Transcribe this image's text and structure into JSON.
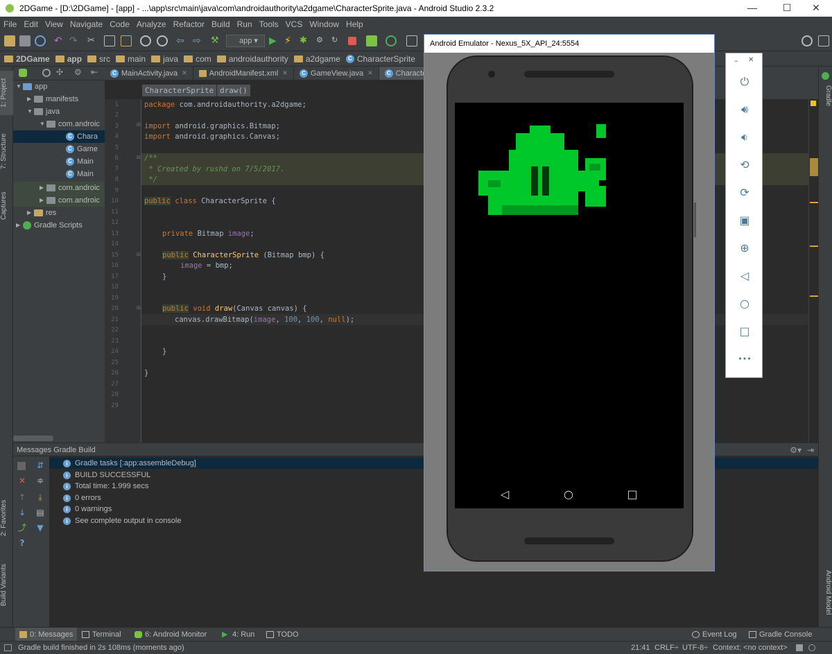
{
  "window": {
    "title": "2DGame - [D:\\2DGame] - [app] - ...\\app\\src\\main\\java\\com\\androidauthority\\a2dgame\\CharacterSprite.java - Android Studio 2.3.2",
    "min": "—",
    "max": "☐",
    "close": "✕"
  },
  "menu": [
    "File",
    "Edit",
    "View",
    "Navigate",
    "Code",
    "Analyze",
    "Refactor",
    "Build",
    "Run",
    "Tools",
    "VCS",
    "Window",
    "Help"
  ],
  "toolbar": {
    "run_config": "app"
  },
  "breadcrumbs": [
    "2DGame",
    "app",
    "src",
    "main",
    "java",
    "com",
    "androidauthority",
    "a2dgame",
    "CharacterSprite"
  ],
  "left_tabs": {
    "project": "1: Project",
    "structure": "7: Structure",
    "captures": "Captures",
    "favorites": "2: Favorites",
    "variants": "Build Variants"
  },
  "right_tabs": {
    "gradle": "Gradle",
    "model": "Android Model"
  },
  "project_tree": [
    {
      "label": "app",
      "kind": "folder"
    },
    {
      "label": "manifests",
      "kind": "folder"
    },
    {
      "label": "java",
      "kind": "folder"
    },
    {
      "label": "com.androic",
      "kind": "folder"
    },
    {
      "label": "Chara",
      "kind": "class"
    },
    {
      "label": "Game",
      "kind": "class"
    },
    {
      "label": "Main",
      "kind": "class"
    },
    {
      "label": "Main",
      "kind": "class"
    },
    {
      "label": "com.androic",
      "kind": "folder"
    },
    {
      "label": "com.androic",
      "kind": "folder"
    },
    {
      "label": "res",
      "kind": "folder"
    },
    {
      "label": "Gradle Scripts",
      "kind": "gradle"
    }
  ],
  "editor_tabs": [
    {
      "label": "MainActivity.java"
    },
    {
      "label": "AndroidManifest.xml"
    },
    {
      "label": "GameView.java"
    },
    {
      "label": "Characte"
    }
  ],
  "editor_crumbs": [
    "CharacterSprite",
    "draw()"
  ],
  "line_numbers": [
    "1",
    "2",
    "3",
    "4",
    "5",
    "6",
    "7",
    "8",
    "9",
    "10",
    "11",
    "12",
    "13",
    "14",
    "15",
    "16",
    "17",
    "18",
    "19",
    "20",
    "21",
    "22",
    "23",
    "24",
    "25",
    "26",
    "27",
    "28",
    "29"
  ],
  "code": {
    "l1_kw": "package",
    "l1_rest": " com.androidauthority.a2dgame;",
    "l4_kw": "import",
    "l4_rest": " android.graphics.Bitmap;",
    "l5_kw": "import",
    "l5_rest": " android.graphics.Canvas;",
    "l7": "/**",
    "l8": " * Created by rushd on 7/5/2017.",
    "l9": " */",
    "l11_kw1": "public",
    "l11_kw2": " class",
    "l11_rest": " CharacterSprite {",
    "l14_kw": "private",
    "l14_type": " Bitmap ",
    "l14_fld": "image",
    "l14_end": ";",
    "l16_kw": "public",
    "l16_fn": " CharacterSprite",
    "l16_rest": " (Bitmap bmp) {",
    "l17_fld": "image",
    "l17_rest": " = bmp;",
    "l18": "}",
    "l20_kw1": "public",
    "l20_kw2": " void",
    "l20_fn": " draw",
    "l20_rest": "(Canvas canvas) {",
    "l21_a": "canvas.drawBitmap(",
    "l21_fld": "image",
    "l21_c1": ", ",
    "l21_n1": "100",
    "l21_c2": ", ",
    "l21_n2": "100",
    "l21_c3": ", ",
    "l21_null": "null",
    "l21_end": ");",
    "l24": "}",
    "l26": "}"
  },
  "messages": {
    "header": "Messages Gradle Build",
    "items": [
      "Gradle tasks [:app:assembleDebug]",
      "BUILD SUCCESSFUL",
      "Total time: 1.999 secs",
      "0 errors",
      "0 warnings",
      "See complete output in console"
    ]
  },
  "bottom_tabs": {
    "messages": "0: Messages",
    "terminal": "Terminal",
    "monitor": "6: Android Monitor",
    "run": "4: Run",
    "todo": "TODO",
    "event_log": "Event Log",
    "gradle_console": "Gradle Console"
  },
  "status": {
    "text": "Gradle build finished in 2s 108ms (moments ago)",
    "position": "21:41",
    "line_sep": "CRLF÷",
    "encoding": "UTF-8÷",
    "context": "Context: <no context>"
  },
  "emulator": {
    "title": "Android Emulator - Nexus_5X_API_24:5554",
    "panel_min": "–",
    "panel_close": "✕",
    "panel_more": "•••"
  },
  "colors": {
    "accent_green": "#00c82a",
    "sprite_dark": "#009a1e"
  }
}
